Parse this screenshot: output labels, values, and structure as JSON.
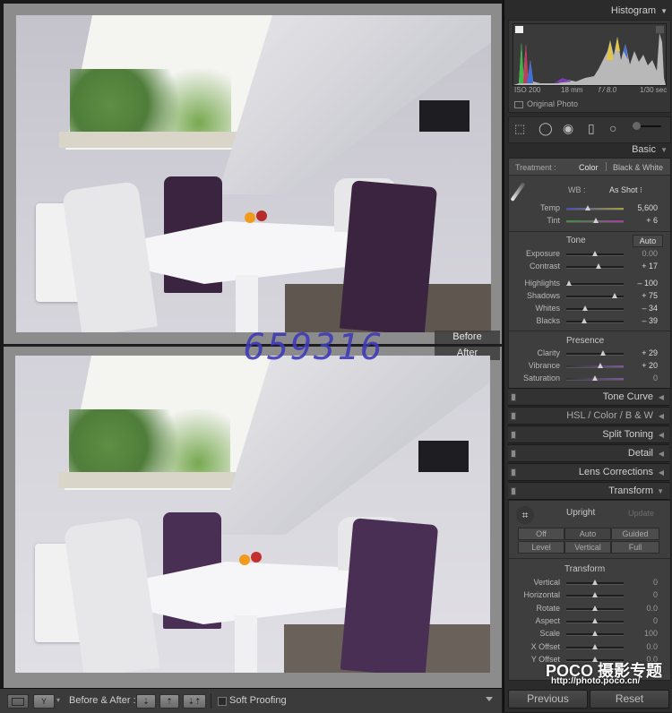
{
  "viewer": {
    "before_label": "Before",
    "after_label": "After",
    "watermark_overlay": "659316"
  },
  "toolbar": {
    "view_mode_icon": "loupe-view-icon",
    "compare_mode_icon": "before-after-split-icon",
    "before_after_label": "Before & After :",
    "copy_before_to_after_icon": "arrow-down-icon",
    "copy_after_to_before_icon": "arrow-up-icon",
    "swap_icon": "swap-arrows-icon",
    "soft_proofing_label": "Soft Proofing",
    "soft_proofing_checked": false,
    "toolbar_menu_icon": "triangle-down-icon"
  },
  "panel": {
    "histogram": {
      "title": "Histogram",
      "iso": "ISO 200",
      "focal_length": "18 mm",
      "aperture": "f / 8.0",
      "shutter": "1/30 sec",
      "original_photo_label": "Original Photo",
      "shadow_clip_icon": "shadow-clipping-icon",
      "highlight_clip_icon": "highlight-clipping-icon"
    },
    "tools": [
      "crop-overlay-icon",
      "spot-removal-icon",
      "red-eye-icon",
      "graduated-filter-icon",
      "radial-filter-icon",
      "adjustment-brush-icon"
    ],
    "basic": {
      "title": "Basic",
      "treatment_label": "Treatment :",
      "treatment_color": "Color",
      "treatment_bw": "Black & White",
      "wb_label": "WB :",
      "wb_value": "As Shot",
      "temp": {
        "label": "Temp",
        "value": "5,600",
        "position": 0.38
      },
      "tint": {
        "label": "Tint",
        "value": "+ 6",
        "position": 0.52
      },
      "tone_label": "Tone",
      "auto_label": "Auto",
      "exposure": {
        "label": "Exposure",
        "value": "0.00",
        "position": 0.5
      },
      "contrast": {
        "label": "Contrast",
        "value": "+ 17",
        "position": 0.57
      },
      "highlights": {
        "label": "Highlights",
        "value": "– 100",
        "position": 0.04
      },
      "shadows": {
        "label": "Shadows",
        "value": "+ 75",
        "position": 0.84
      },
      "whites": {
        "label": "Whites",
        "value": "– 34",
        "position": 0.33
      },
      "blacks": {
        "label": "Blacks",
        "value": "– 39",
        "position": 0.31
      },
      "presence_label": "Presence",
      "clarity": {
        "label": "Clarity",
        "value": "+ 29",
        "position": 0.64
      },
      "vibrance": {
        "label": "Vibrance",
        "value": "+ 20",
        "position": 0.6
      },
      "saturation": {
        "label": "Saturation",
        "value": "0",
        "position": 0.5
      }
    },
    "collapsed_sections": [
      {
        "title": "Tone Curve"
      },
      {
        "title": "HSL  /  Color  /  B & W"
      },
      {
        "title": "Split Toning"
      },
      {
        "title": "Detail"
      },
      {
        "title": "Lens Corrections"
      }
    ],
    "transform": {
      "title": "Transform",
      "upright_label": "Upright",
      "update_label": "Update",
      "upright_buttons": [
        "Off",
        "Auto",
        "Guided",
        "Level",
        "Vertical",
        "Full"
      ],
      "sub_title": "Transform",
      "sliders": [
        {
          "label": "Vertical",
          "value": "0",
          "position": 0.5
        },
        {
          "label": "Horizontal",
          "value": "0",
          "position": 0.5
        },
        {
          "label": "Rotate",
          "value": "0.0",
          "position": 0.5
        },
        {
          "label": "Aspect",
          "value": "0",
          "position": 0.5
        },
        {
          "label": "Scale",
          "value": "100",
          "position": 0.5
        },
        {
          "label": "X Offset",
          "value": "0.0",
          "position": 0.5
        },
        {
          "label": "Y Offset",
          "value": "0.0",
          "position": 0.5
        }
      ]
    },
    "watermark_brand": "POCO 摄影专题",
    "watermark_url": "http://photo.poco.cn/",
    "previous_label": "Previous",
    "reset_label": "Reset"
  }
}
